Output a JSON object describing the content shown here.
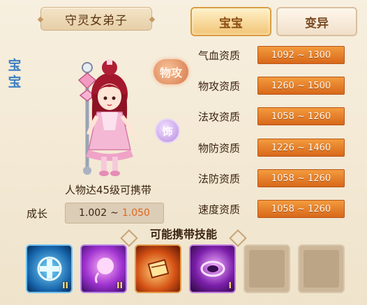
{
  "pet": {
    "name": "守灵女弟子",
    "type_vertical": "宝宝",
    "carry_level": "人物达45级可携带",
    "growth_label": "成长",
    "growth_min": "1.002",
    "growth_sep": "~",
    "growth_max": "1.050"
  },
  "tags": {
    "attack_type": "物攻",
    "decoration": "饰"
  },
  "tabs": [
    {
      "label": "宝宝",
      "active": true
    },
    {
      "label": "变异",
      "active": false
    }
  ],
  "stats": [
    {
      "label": "气血资质",
      "value": "1092 ~ 1300"
    },
    {
      "label": "物攻资质",
      "value": "1260 ~ 1500"
    },
    {
      "label": "法攻资质",
      "value": "1058 ~ 1260"
    },
    {
      "label": "物防资质",
      "value": "1226 ~ 1460"
    },
    {
      "label": "法防资质",
      "value": "1058 ~ 1260"
    },
    {
      "label": "速度资质",
      "value": "1058 ~ 1260"
    }
  ],
  "skills": {
    "title": "可能携带技能",
    "slots": [
      {
        "icon": "blue-cross-skill-icon",
        "rank": "II"
      },
      {
        "icon": "pink-orb-skill-icon",
        "rank": "II"
      },
      {
        "icon": "orange-book-skill-icon",
        "rank": ""
      },
      {
        "icon": "purple-vortex-skill-icon",
        "rank": "I"
      },
      {
        "icon": "empty-slot",
        "rank": ""
      },
      {
        "icon": "empty-slot",
        "rank": ""
      }
    ]
  }
}
